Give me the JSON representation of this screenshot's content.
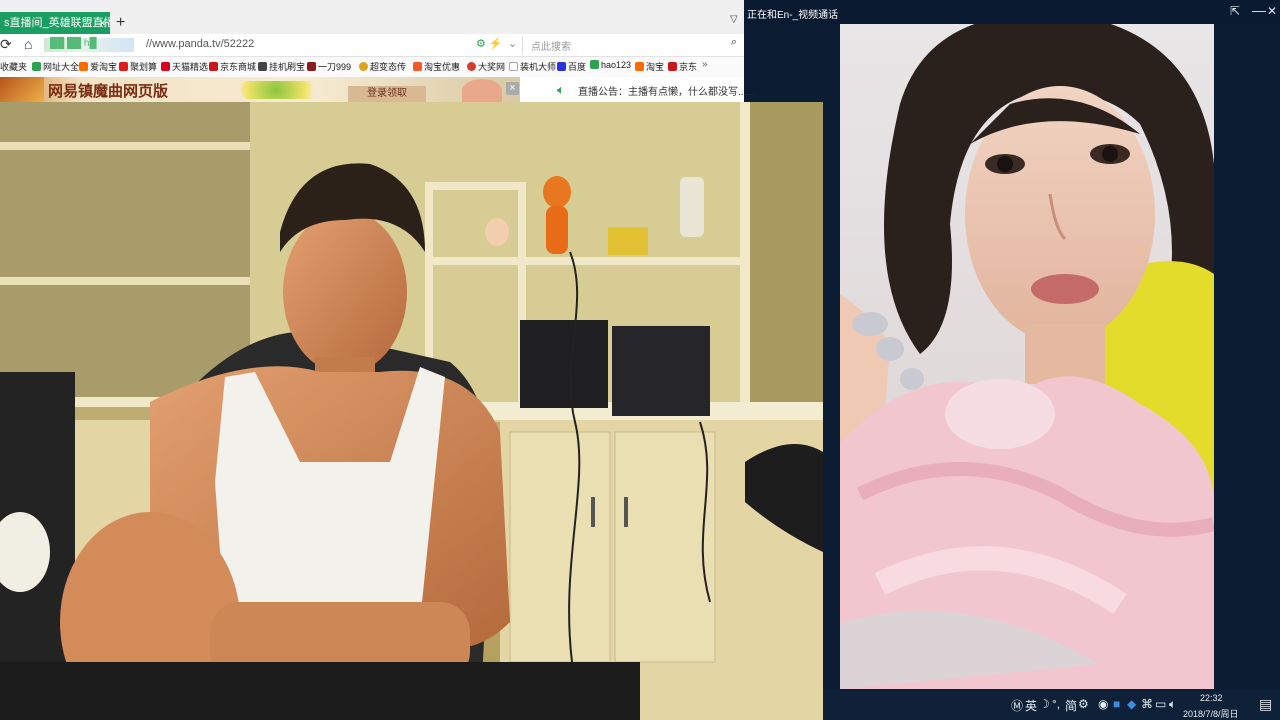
{
  "browser": {
    "tab_title": "s直播间_英雄联盟直播 lo",
    "tab_close": "×",
    "new_tab": "+",
    "tab_menu": "▽",
    "url": "//www.panda.tv/52222",
    "url_blurred": "██ ██ h█",
    "search_placeholder": "点此搜索",
    "bookmarks": [
      {
        "label": "收藏夹",
        "color": "#f3b33c"
      },
      {
        "label": "网址大全",
        "color": "#2aa44f"
      },
      {
        "label": "爱淘宝",
        "color": "#ff6a00"
      },
      {
        "label": "聚划算",
        "color": "#e21b1b"
      },
      {
        "label": "天猫精选",
        "color": "#d9001b"
      },
      {
        "label": "京东商城",
        "color": "#c8161d"
      },
      {
        "label": "挂机刷宝",
        "color": "#444444"
      },
      {
        "label": "一刀999",
        "color": "#8a1c1c"
      },
      {
        "label": "超变态传",
        "color": "#e0a219"
      },
      {
        "label": "淘宝优惠",
        "color": "#f05a28"
      },
      {
        "label": "大奖网",
        "color": "#d43c2c"
      },
      {
        "label": "装机大师",
        "color": "#5b8def"
      },
      {
        "label": "百度",
        "color": "#2932e1"
      },
      {
        "label": "hao123",
        "color": "#2aa44f"
      },
      {
        "label": "淘宝",
        "color": "#ff6a00"
      },
      {
        "label": "京东",
        "color": "#c8161d"
      }
    ],
    "bookmarks_more": "»",
    "ad": {
      "text": "网易镇魔曲网页版",
      "button": "登录领取",
      "close": "×"
    },
    "announcement": "直播公告：主播有点懒，什么都没写......"
  },
  "video_call": {
    "title": "正在和En-_视频通话",
    "pin": "⇱",
    "minimize": "—",
    "close": "✕"
  },
  "taskbar": {
    "ime": "英",
    "ime_mode": "简",
    "time": "22:32",
    "date": "2018/7/8/周日"
  },
  "colors": {
    "stream_accent": "#1a9e62",
    "taskbar_bg": "#0f2139"
  }
}
